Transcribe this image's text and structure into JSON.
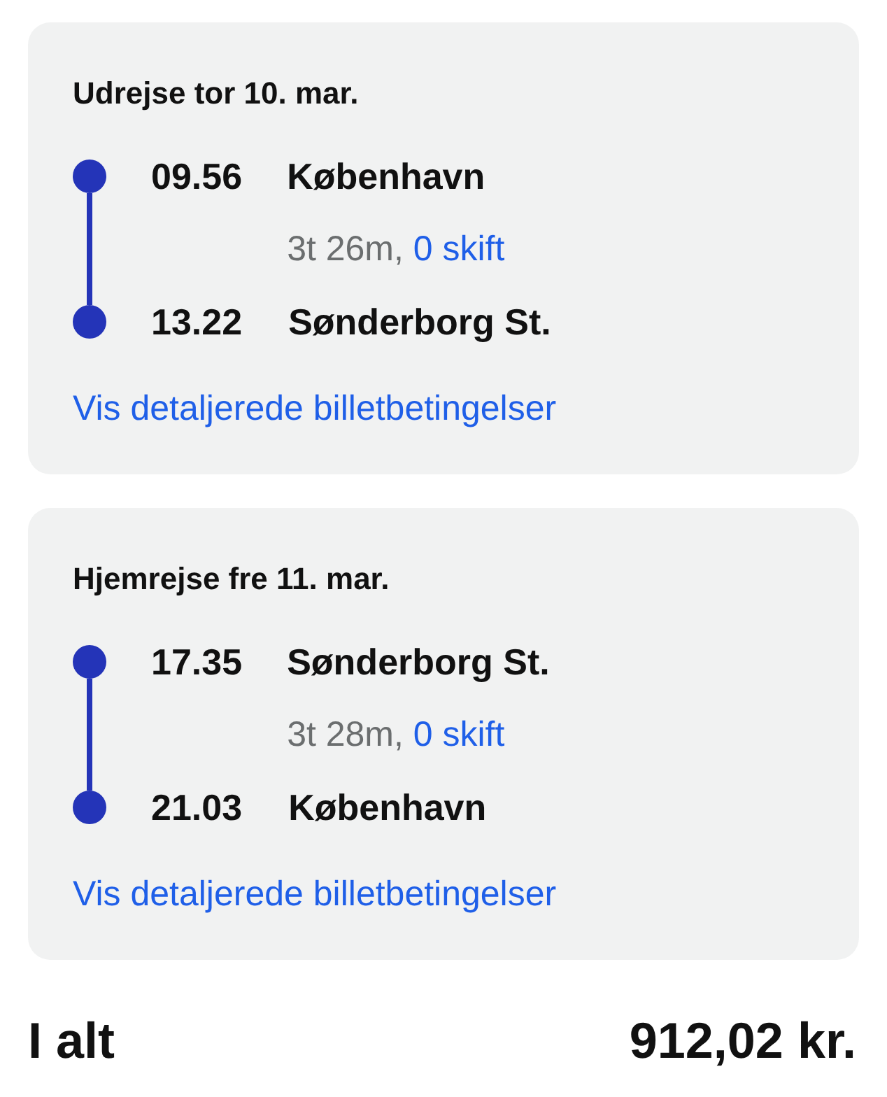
{
  "journeys": [
    {
      "title": "Udrejse tor 10. mar.",
      "departure": {
        "time": "09.56",
        "station": "København"
      },
      "duration": "3t 26m,",
      "changes": "0 skift",
      "arrival": {
        "time": "13.22",
        "station": "Sønderborg St."
      },
      "link": "Vis detaljerede billetbetingelser"
    },
    {
      "title": "Hjemrejse fre 11. mar.",
      "departure": {
        "time": "17.35",
        "station": "Sønderborg St."
      },
      "duration": "3t 28m,",
      "changes": "0 skift",
      "arrival": {
        "time": "21.03",
        "station": "København"
      },
      "link": "Vis detaljerede billetbetingelser"
    }
  ],
  "total": {
    "label": "I alt",
    "amount": "912,02 kr."
  }
}
